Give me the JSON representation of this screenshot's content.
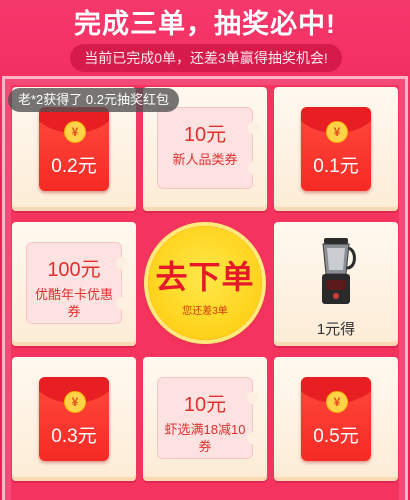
{
  "header": {
    "title": "完成三单，抽奖必中!",
    "subtitle": "当前已完成0单，还差3单赢得抽奖机会!"
  },
  "toast": {
    "text": "老*2获得了 0.2元抽奖红包"
  },
  "prizes": {
    "c1": {
      "type": "envelope",
      "amount": "0.2元",
      "coin": "¥"
    },
    "c2": {
      "type": "coupon",
      "amount": "10元",
      "desc": "新人品类券"
    },
    "c3": {
      "type": "envelope",
      "amount": "0.1元",
      "coin": "¥"
    },
    "c4": {
      "type": "coupon",
      "amount": "100元",
      "desc": "优酷年卡优惠券"
    },
    "c6": {
      "type": "product",
      "label": "1元得",
      "icon": "blender-icon"
    },
    "c7": {
      "type": "envelope",
      "amount": "0.3元",
      "coin": "¥"
    },
    "c8": {
      "type": "coupon",
      "amount": "10元",
      "desc": "虾选满18减10券"
    },
    "c9": {
      "type": "envelope",
      "amount": "0.5元",
      "coin": "¥"
    }
  },
  "center": {
    "label": "去下单",
    "sub": "您还差3单"
  },
  "colors": {
    "background": "#f02053",
    "envelope": "#f52a25",
    "button": "#ffd21a",
    "buttonText": "#e8182b"
  }
}
